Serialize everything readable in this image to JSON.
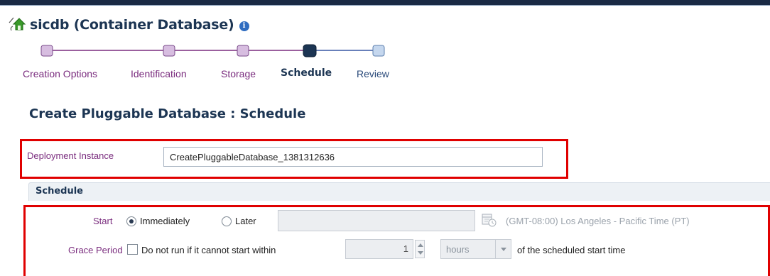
{
  "header": {
    "title": "sicdb (Container Database)",
    "info_glyph": "i",
    "icon": "home-icon"
  },
  "train": {
    "steps": [
      {
        "label": "Creation Options",
        "state": "visited"
      },
      {
        "label": "Identification",
        "state": "visited"
      },
      {
        "label": "Storage",
        "state": "visited"
      },
      {
        "label": "Schedule",
        "state": "current"
      },
      {
        "label": "Review",
        "state": "future"
      }
    ]
  },
  "page": {
    "title": "Create Pluggable Database : Schedule"
  },
  "deployment": {
    "label": "Deployment Instance",
    "value": "CreatePluggableDatabase_1381312636"
  },
  "schedule": {
    "header": "Schedule",
    "start_label": "Start",
    "immediately_label": "Immediately",
    "later_label": "Later",
    "timezone": "(GMT-08:00) Los Angeles - Pacific Time (PT)",
    "grace_label": "Grace Period",
    "grace_checkbox_label": "Do not run if it cannot start within",
    "grace_value": "1",
    "grace_unit": "hours",
    "grace_suffix": "of the scheduled start time"
  },
  "colors": {
    "highlight_box": "#e00000",
    "visited_step": "#7a2c7e",
    "current_step": "#1c3553"
  }
}
